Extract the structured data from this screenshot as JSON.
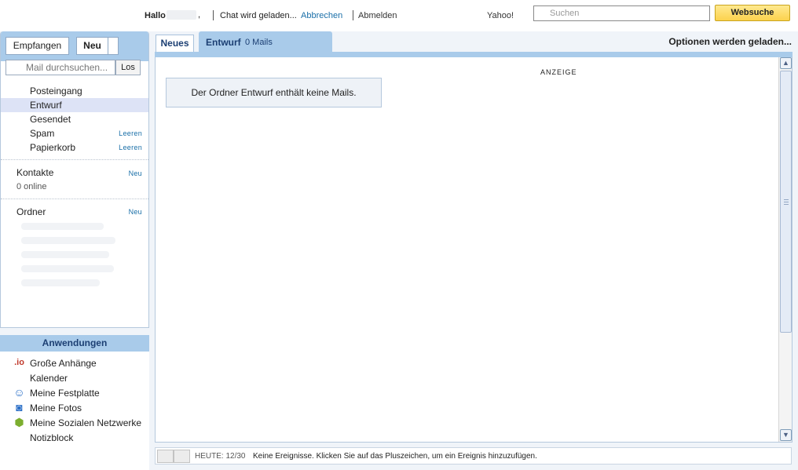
{
  "topbar": {
    "hallo": "Hallo",
    "comma": ",",
    "chat_loading": "Chat wird geladen...",
    "cancel_link": "Abbrechen",
    "logout": "Abmelden",
    "yahoo_label": "Yahoo!",
    "search_placeholder": "Suchen",
    "websearch_button": "Websuche"
  },
  "sidebar": {
    "receive_button": "Empfangen",
    "new_button": "Neu",
    "mail_search_placeholder": "Mail durchsuchen...",
    "search_go": "Los",
    "folders": [
      {
        "name": "Posteingang",
        "action": ""
      },
      {
        "name": "Entwurf",
        "action": "",
        "active": true
      },
      {
        "name": "Gesendet",
        "action": ""
      },
      {
        "name": "Spam",
        "action": "Leeren"
      },
      {
        "name": "Papierkorb",
        "action": "Leeren"
      }
    ],
    "contacts_title": "Kontakte",
    "contacts_new": "Neu",
    "contacts_online": "0 online",
    "folders_title": "Ordner",
    "folders_new": "Neu"
  },
  "apps": {
    "title": "Anwendungen",
    "items": [
      {
        "label": "Große Anhänge",
        "icon": "io-icon",
        "glyph": ".io",
        "color": "#c0392b"
      },
      {
        "label": "Kalender",
        "icon": "",
        "glyph": "",
        "color": ""
      },
      {
        "label": "Meine Festplatte",
        "icon": "hard-drive-mascot-icon",
        "glyph": "☺",
        "color": "#2b6fc7"
      },
      {
        "label": "Meine Fotos",
        "icon": "camera-icon",
        "glyph": "◙",
        "color": "#2b6fc7"
      },
      {
        "label": "Meine Sozialen Netzwerke",
        "icon": "hexagon-network-icon",
        "glyph": "⬢",
        "color": "#7cae2f"
      },
      {
        "label": "Notizblock",
        "icon": "",
        "glyph": "",
        "color": ""
      }
    ]
  },
  "main": {
    "tab_news": "Neues",
    "tab_draft": "Entwurf",
    "tab_draft_count": "0 Mails",
    "options_loading": "Optionen werden geladen...",
    "ad_label": "ANZEIGE",
    "empty_message": "Der Ordner Entwurf enthält keine Mails."
  },
  "calendar_bar": {
    "today": "HEUTE: 12/30",
    "message": "Keine Ereignisse. Klicken Sie auf das Pluszeichen, um ein Ereignis hinzuzufügen."
  },
  "colors": {
    "accent_blue": "#a9cbea",
    "link_blue": "#1a6fa8",
    "websearch_yellow": "#fcd24d"
  }
}
